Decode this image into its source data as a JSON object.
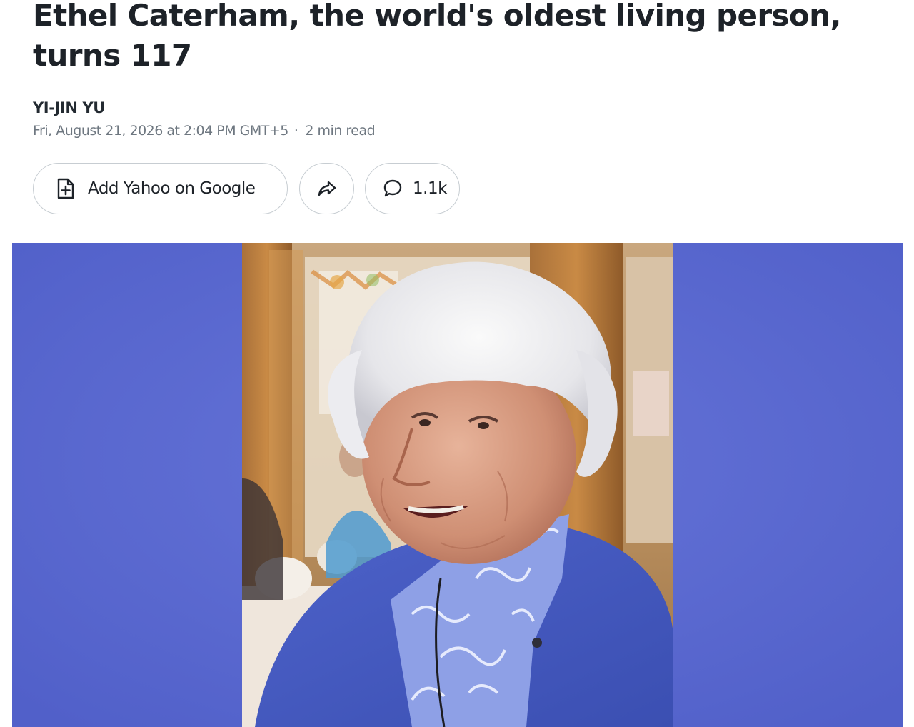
{
  "article": {
    "headline": "Ethel Caterham, the world's oldest living person, turns 117",
    "author": "YI-JIN YU",
    "published": "Fri, August 21, 2026 at 2:04 PM GMT+5",
    "separator": "·",
    "read_time": "2 min read"
  },
  "actions": {
    "add_google_label": "Add Yahoo on Google",
    "add_google_icon": "document-plus-icon",
    "share_icon": "share-arrow-icon",
    "comments_icon": "speech-bubble-icon",
    "comments_count": "1.1k"
  },
  "hero_image": {
    "subject": "photo-of-elderly-woman-smiling",
    "background_color": "#5a6bd0",
    "cardigan_color": "#4a5fc4"
  }
}
